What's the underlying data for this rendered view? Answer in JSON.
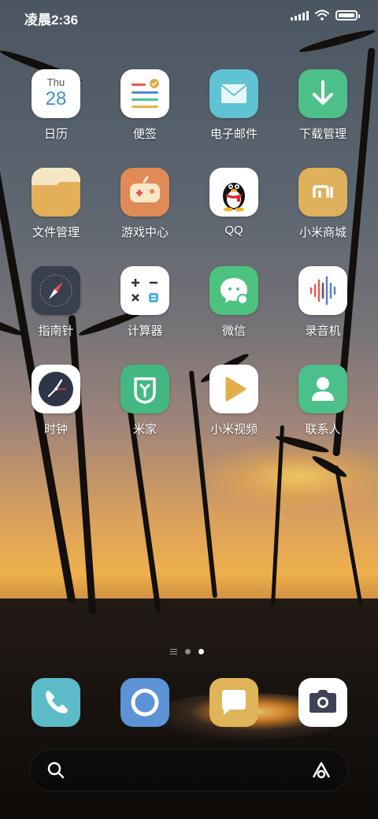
{
  "status_bar": {
    "time": "凌晨2:36"
  },
  "apps": [
    {
      "label": "日历",
      "icon": "calendar-icon",
      "day": "Thu",
      "date": "28"
    },
    {
      "label": "便签",
      "icon": "notes-icon"
    },
    {
      "label": "电子邮件",
      "icon": "email-icon"
    },
    {
      "label": "下载管理",
      "icon": "download-icon"
    },
    {
      "label": "文件管理",
      "icon": "folder-icon"
    },
    {
      "label": "游戏中心",
      "icon": "gamepad-icon"
    },
    {
      "label": "QQ",
      "icon": "qq-penguin-icon"
    },
    {
      "label": "小米商城",
      "icon": "mi-store-icon",
      "logo_text": "mi"
    },
    {
      "label": "指南针",
      "icon": "compass-icon"
    },
    {
      "label": "计算器",
      "icon": "calculator-icon"
    },
    {
      "label": "微信",
      "icon": "wechat-icon"
    },
    {
      "label": "录音机",
      "icon": "recorder-icon"
    },
    {
      "label": "时钟",
      "icon": "clock-icon"
    },
    {
      "label": "米家",
      "icon": "mijia-icon"
    },
    {
      "label": "小米视频",
      "icon": "video-play-icon"
    },
    {
      "label": "联系人",
      "icon": "contacts-icon"
    }
  ],
  "page_indicator": {
    "pages": 2,
    "current": 2
  },
  "dock": [
    {
      "icon": "phone-icon"
    },
    {
      "icon": "browser-icon"
    },
    {
      "icon": "messages-icon"
    },
    {
      "icon": "camera-icon"
    }
  ],
  "search_bar": {
    "icon": "search-icon",
    "assistant_icon": "xiaoai-assistant-icon"
  },
  "colors": {
    "mail": "#5fc3d3",
    "download": "#4dc08a",
    "folder": "#e6b35c",
    "game": "#e08a55",
    "mi_store": "#dfb15c",
    "wechat": "#4cc27e",
    "mijia": "#43b882",
    "contacts": "#4cc08b",
    "phone": "#5bbcc8",
    "browser": "#5b93d6",
    "messages": "#e0b458"
  }
}
